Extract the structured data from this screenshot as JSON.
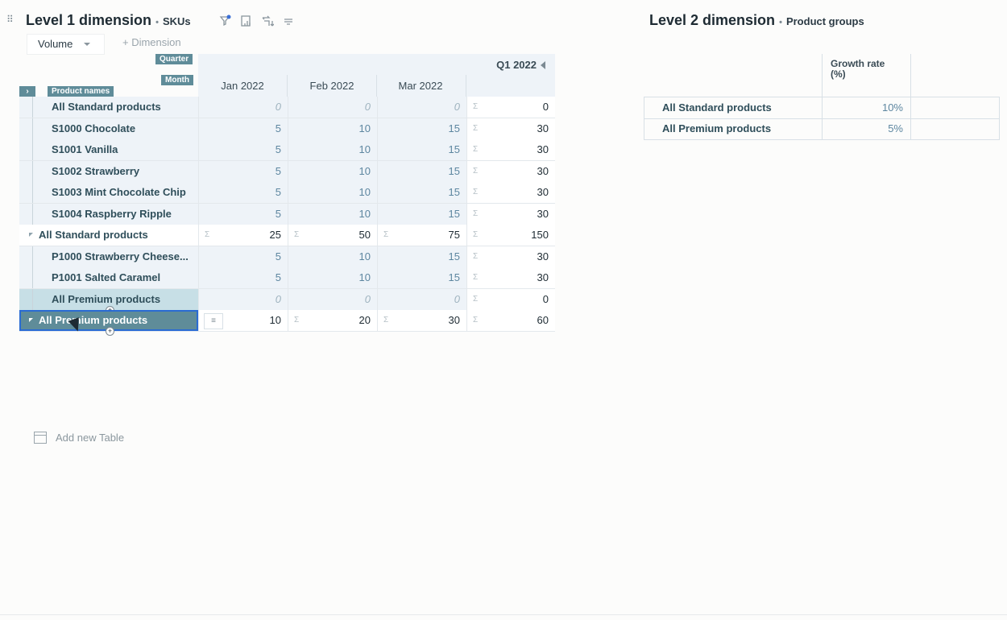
{
  "level1": {
    "title": "Level 1 dimension",
    "subtitle": "SKUs",
    "volume_label": "Volume",
    "add_dimension_label": "+ Dimension",
    "tags": {
      "quarter": "Quarter",
      "month": "Month",
      "product_names": "Product names"
    },
    "quarter_label": "Q1 2022",
    "months": [
      "Jan 2022",
      "Feb 2022",
      "Mar 2022"
    ],
    "rows": [
      {
        "label": "All Standard products",
        "values": [
          "0",
          "0",
          "0",
          "0"
        ]
      },
      {
        "label": "S1000 Chocolate",
        "values": [
          "5",
          "10",
          "15",
          "30"
        ]
      },
      {
        "label": "S1001 Vanilla",
        "values": [
          "5",
          "10",
          "15",
          "30"
        ]
      },
      {
        "label": "S1002 Strawberry",
        "values": [
          "5",
          "10",
          "15",
          "30"
        ]
      },
      {
        "label": "S1003 Mint Chocolate Chip",
        "values": [
          "5",
          "10",
          "15",
          "30"
        ]
      },
      {
        "label": "S1004 Raspberry Ripple",
        "values": [
          "5",
          "10",
          "15",
          "30"
        ]
      },
      {
        "label": "All Standard products",
        "values": [
          "25",
          "50",
          "75",
          "150"
        ]
      },
      {
        "label": "P1000 Strawberry Cheese...",
        "values": [
          "5",
          "10",
          "15",
          "30"
        ]
      },
      {
        "label": "P1001 Salted Caramel",
        "values": [
          "5",
          "10",
          "15",
          "30"
        ]
      },
      {
        "label": "All Premium products",
        "values": [
          "0",
          "0",
          "0",
          "0"
        ]
      },
      {
        "label": "All Premium products",
        "values": [
          "10",
          "20",
          "30",
          "60"
        ]
      }
    ]
  },
  "level2": {
    "title": "Level 2 dimension",
    "subtitle": "Product groups",
    "column_header": "Growth rate (%)",
    "rows": [
      {
        "label": "All Standard products",
        "value": "10%"
      },
      {
        "label": "All Premium products",
        "value": "5%"
      }
    ]
  },
  "add_table_label": "Add new Table",
  "sigma": "Σ",
  "colors": {
    "accent": "#5f8c99",
    "selection": "#2a6bd3",
    "input_text": "#5d86a0"
  }
}
